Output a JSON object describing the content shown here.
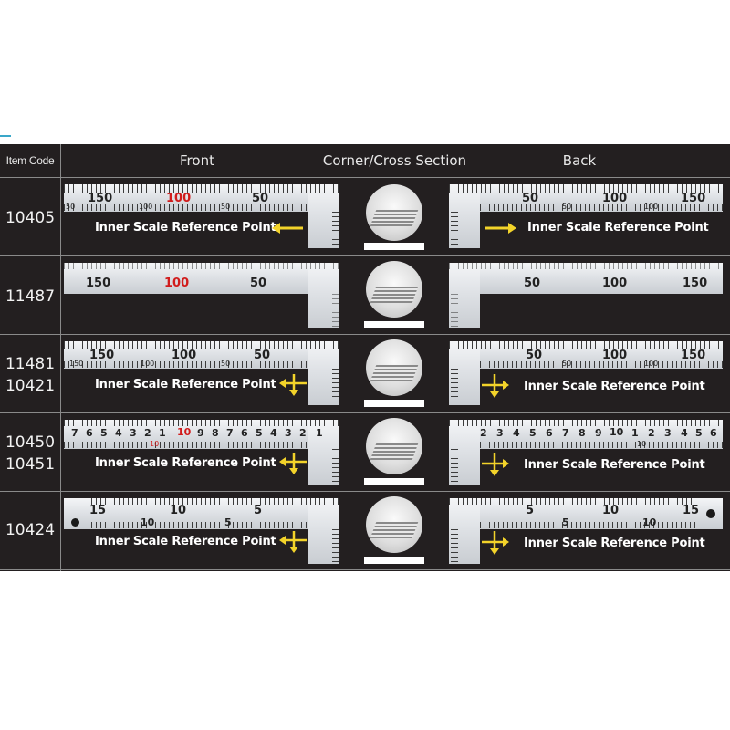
{
  "headers": {
    "item_code": "Item Code",
    "front": "Front",
    "corner": "Corner/Cross Section",
    "back": "Back"
  },
  "colors": {
    "background": "#231f20",
    "arrow": "#f3d32a",
    "label": "#ffffff",
    "red_number": "#d11c1c"
  },
  "rows": [
    {
      "codes": [
        "10405"
      ],
      "front": {
        "label": "Inner Scale Reference Point",
        "arrow": "left-arrow",
        "numbers_top": [
          "150",
          "100",
          "50"
        ],
        "numbers_bottom": [
          "50",
          "100",
          "50"
        ]
      },
      "back": {
        "label": "Inner Scale Reference Point",
        "arrow": "right-arrow",
        "numbers_top": [
          "50",
          "100",
          "150"
        ],
        "numbers_bottom": [
          "50",
          "100"
        ]
      }
    },
    {
      "codes": [
        "11487"
      ],
      "front": {
        "numbers": [
          "150",
          "100",
          "50"
        ]
      },
      "back": {
        "numbers": [
          "50",
          "100",
          "150"
        ]
      }
    },
    {
      "codes": [
        "11481",
        "10421"
      ],
      "front": {
        "label": "Inner Scale Reference Point",
        "arrow": "cross-arrow",
        "numbers_top": [
          "150",
          "100",
          "50"
        ],
        "numbers_bottom": [
          "150",
          "100",
          "50"
        ]
      },
      "back": {
        "label": "Inner Scale Reference Point",
        "arrow": "cross-arrow",
        "numbers_top": [
          "50",
          "100",
          "150"
        ],
        "numbers_bottom": [
          "50",
          "100"
        ]
      }
    },
    {
      "codes": [
        "10450",
        "10451"
      ],
      "front": {
        "label": "Inner Scale Reference Point",
        "arrow": "cross-arrow",
        "numbers_top": [
          "7",
          "6",
          "5",
          "4",
          "3",
          "2",
          "1",
          "10",
          "9",
          "8",
          "7",
          "6",
          "5",
          "4",
          "3",
          "2",
          "1"
        ],
        "numbers_bottom": [
          "10"
        ]
      },
      "back": {
        "label": "Inner Scale Reference Point",
        "arrow": "cross-arrow",
        "numbers_top": [
          "2",
          "3",
          "4",
          "5",
          "6",
          "7",
          "8",
          "9",
          "10",
          "1",
          "2",
          "3",
          "4",
          "5",
          "6"
        ],
        "numbers_bottom": [
          "10"
        ]
      }
    },
    {
      "codes": [
        "10424"
      ],
      "front": {
        "label": "Inner Scale Reference Point",
        "arrow": "cross-arrow",
        "numbers_top": [
          "15",
          "10",
          "5"
        ],
        "numbers_bottom": [
          "10",
          "5"
        ]
      },
      "back": {
        "label": "Inner Scale Reference Point",
        "arrow": "cross-arrow",
        "numbers_top": [
          "5",
          "10",
          "15"
        ],
        "numbers_bottom": [
          "5",
          "10"
        ]
      }
    }
  ]
}
